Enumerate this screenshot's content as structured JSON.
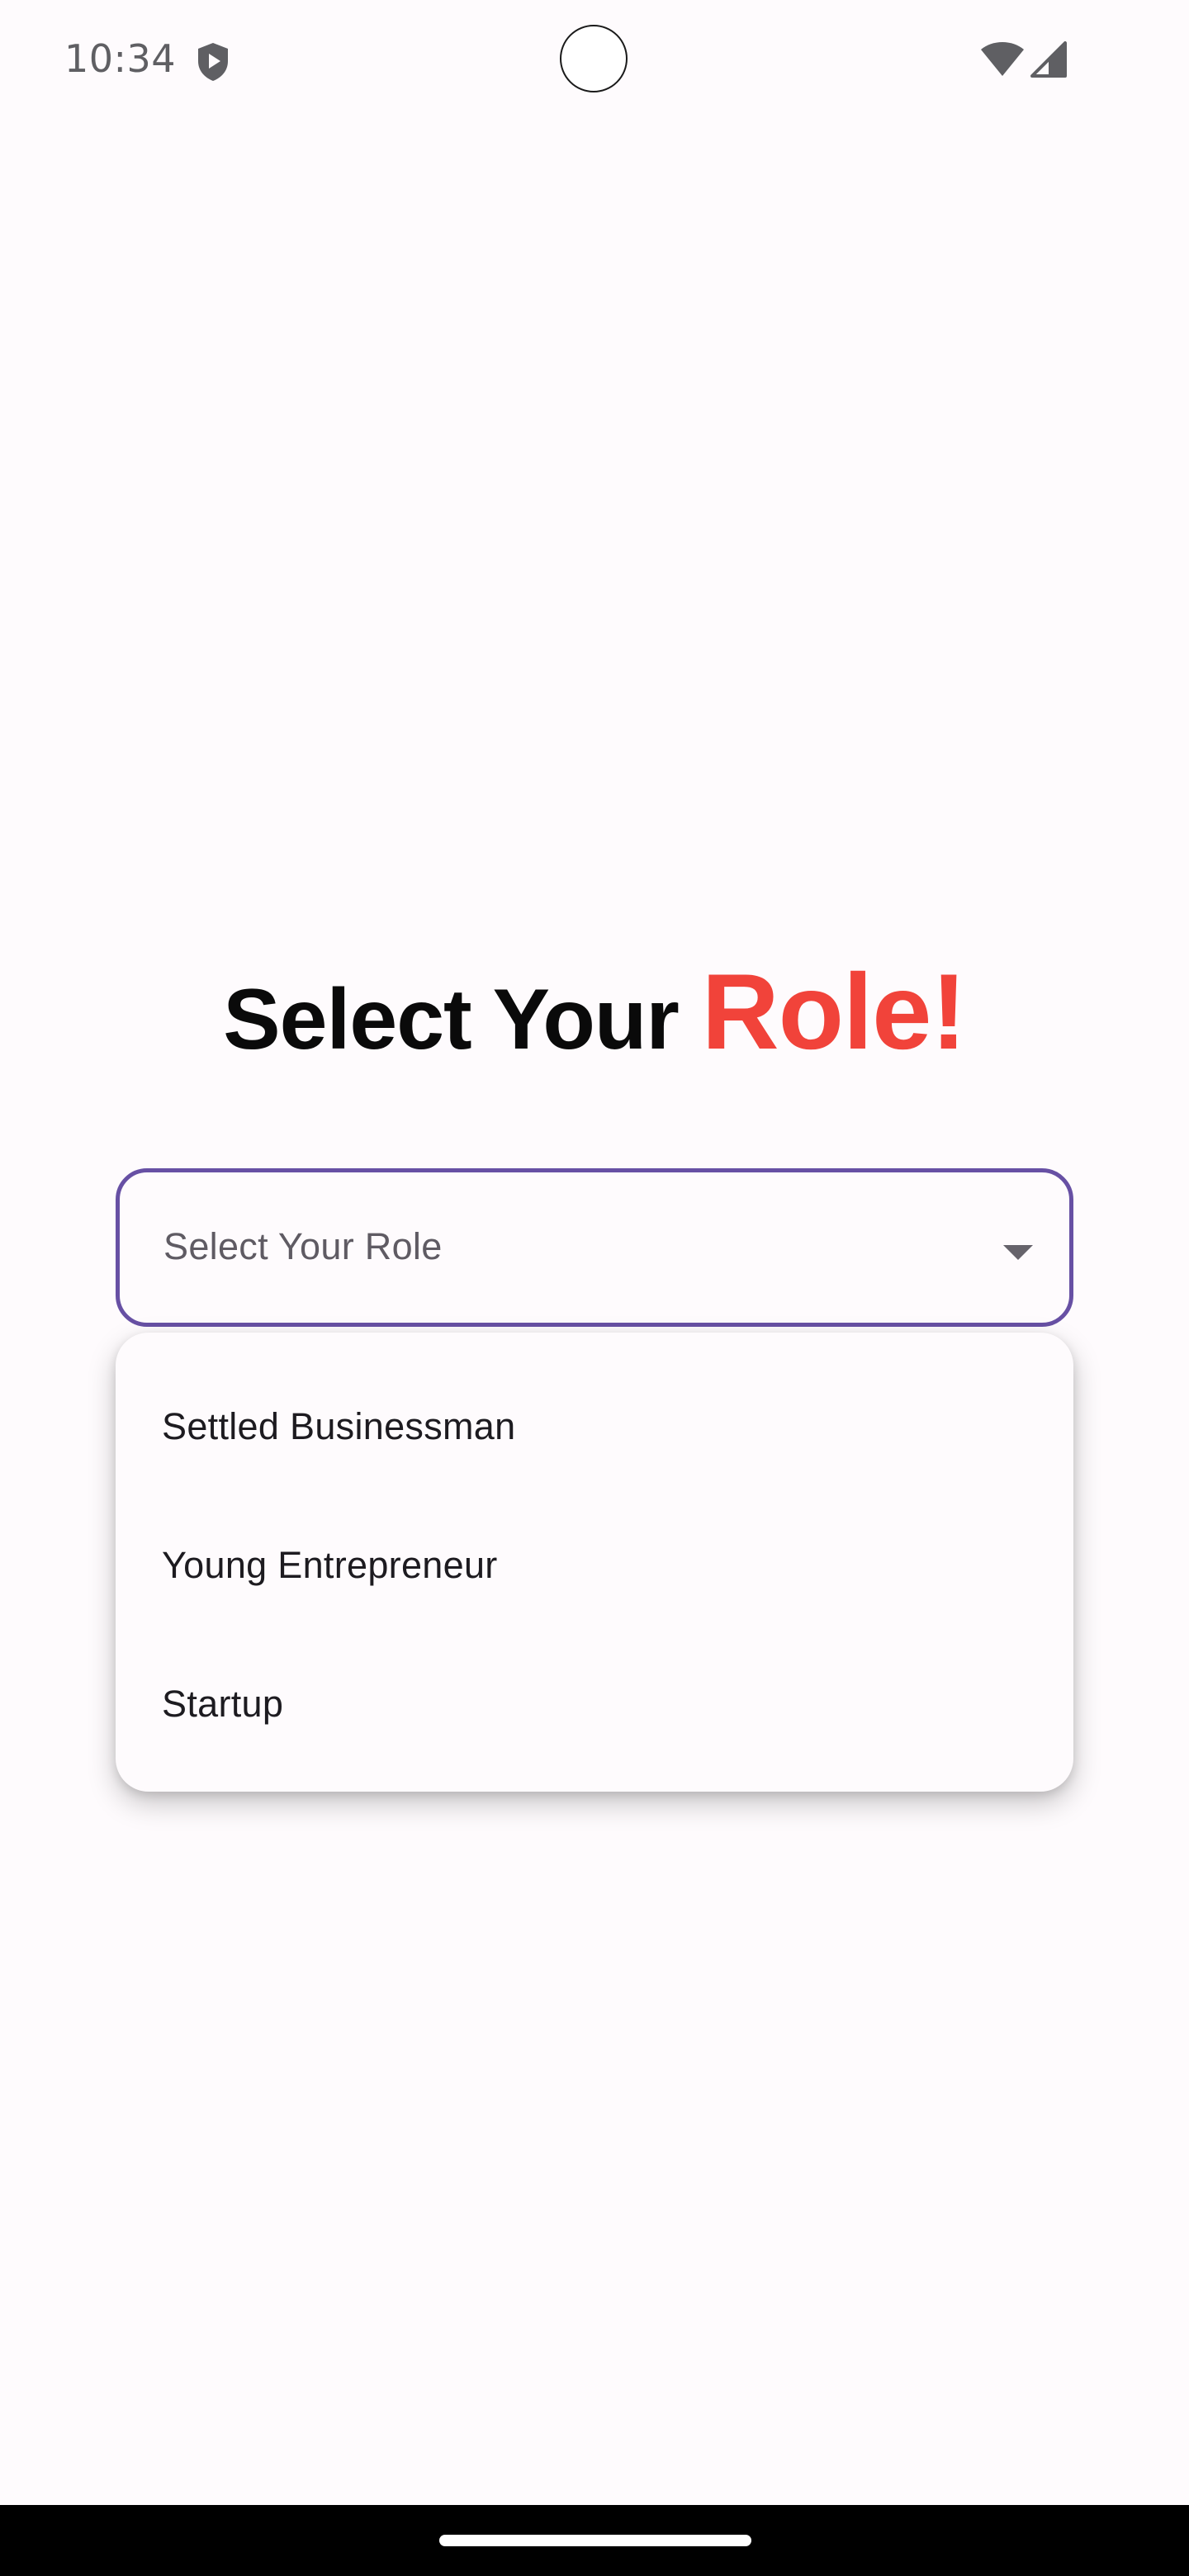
{
  "status_bar": {
    "time": "10:34",
    "icons": [
      "shield-play-icon",
      "wifi-icon",
      "cell-signal-icon"
    ]
  },
  "title": {
    "main": "Select Your ",
    "accent": "Role!"
  },
  "role_select": {
    "placeholder": "Select Your Role",
    "expanded": true
  },
  "role_menu": {
    "items": [
      {
        "label": "Settled Businessman"
      },
      {
        "label": "Young Entrepreneur"
      },
      {
        "label": "Startup"
      }
    ]
  },
  "colors": {
    "background": "#fefbfd",
    "accent": "#f1433a",
    "outline": "#6750a4",
    "title": "#0a0a0a"
  }
}
